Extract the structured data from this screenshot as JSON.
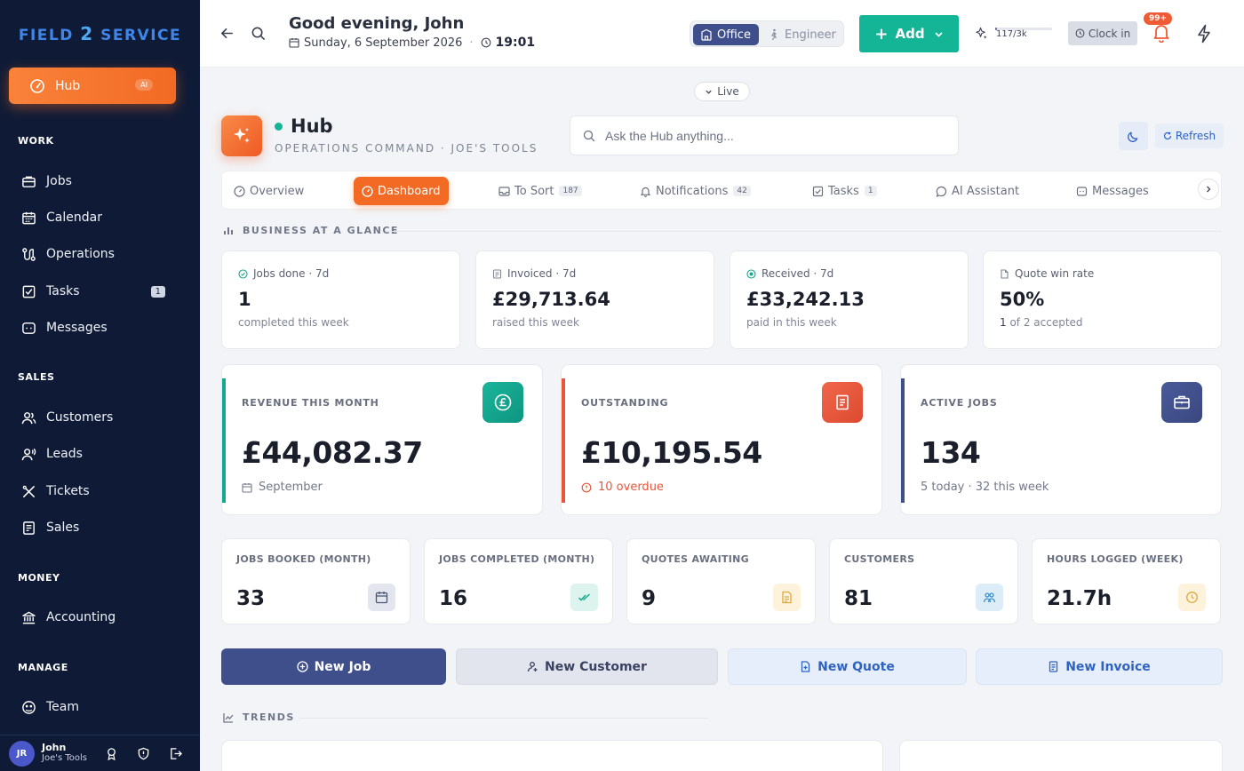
{
  "brand": {
    "logo_left": "FIELD",
    "logo_two": "2",
    "logo_right": "SERVICE"
  },
  "sidebar": {
    "hub": {
      "label": "Hub",
      "badge": "AI"
    },
    "sections": {
      "work": "WORK",
      "sales": "SALES",
      "money": "MONEY",
      "manage": "MANAGE"
    },
    "items": {
      "jobs": "Jobs",
      "calendar": "Calendar",
      "operations": "Operations",
      "tasks": "Tasks",
      "tasks_count": "1",
      "messages": "Messages",
      "customers": "Customers",
      "leads": "Leads",
      "tickets": "Tickets",
      "sales": "Sales",
      "accounting": "Accounting",
      "team": "Team"
    },
    "user": {
      "initials": "JR",
      "name": "John",
      "company": "Joe's Tools"
    }
  },
  "topbar": {
    "greeting": "Good evening, John",
    "date": "Sunday, 6 September 2026",
    "separator": "·",
    "time": "19:01",
    "mode_office": "Office",
    "mode_engineer": "Engineer",
    "add_label": "Add",
    "usage": "117/3k",
    "usage_fraction": 0.039,
    "clock_in": "Clock in",
    "notif_badge": "99+"
  },
  "live_label": "Live",
  "hub": {
    "title": "Hub",
    "subtitle": "OPERATIONS COMMAND · JOE'S TOOLS",
    "search_placeholder": "Ask the Hub anything...",
    "refresh": "Refresh"
  },
  "tabs": {
    "overview": "Overview",
    "dashboard": "Dashboard",
    "to_sort": "To Sort",
    "to_sort_count": "187",
    "notifications": "Notifications",
    "notifications_count": "42",
    "tasks": "Tasks",
    "tasks_count": "1",
    "ai": "AI Assistant",
    "messages": "Messages"
  },
  "glance": {
    "heading": "BUSINESS AT A GLANCE",
    "cards": [
      {
        "label": "Jobs done · 7d",
        "value": "1",
        "sub": "completed this week"
      },
      {
        "label": "Invoiced · 7d",
        "value": "£29,713.64",
        "sub": "raised this week"
      },
      {
        "label": "Received · 7d",
        "value": "£33,242.13",
        "sub": "paid in this week"
      },
      {
        "label": "Quote win rate",
        "value": "50%",
        "sub_strong": "1",
        "sub": " of 2 accepted"
      }
    ]
  },
  "kpis": [
    {
      "label": "REVENUE THIS MONTH",
      "value": "£44,082.37",
      "sub": "September",
      "color": "#14a98f"
    },
    {
      "label": "OUTSTANDING",
      "value": "£10,195.54",
      "sub": "10 overdue",
      "color": "#e8553a"
    },
    {
      "label": "ACTIVE JOBS",
      "value": "134",
      "sub": "5 today · 32 this week",
      "color": "#3f4f8c"
    }
  ],
  "stats": [
    {
      "label": "JOBS BOOKED (MONTH)",
      "value": "33"
    },
    {
      "label": "JOBS COMPLETED (MONTH)",
      "value": "16"
    },
    {
      "label": "QUOTES AWAITING",
      "value": "9"
    },
    {
      "label": "CUSTOMERS",
      "value": "81"
    },
    {
      "label": "HOURS LOGGED (WEEK)",
      "value": "21.7h"
    }
  ],
  "actions": {
    "new_job": "New Job",
    "new_customer": "New Customer",
    "new_quote": "New Quote",
    "new_invoice": "New Invoice"
  },
  "trends_heading": "TRENDS"
}
